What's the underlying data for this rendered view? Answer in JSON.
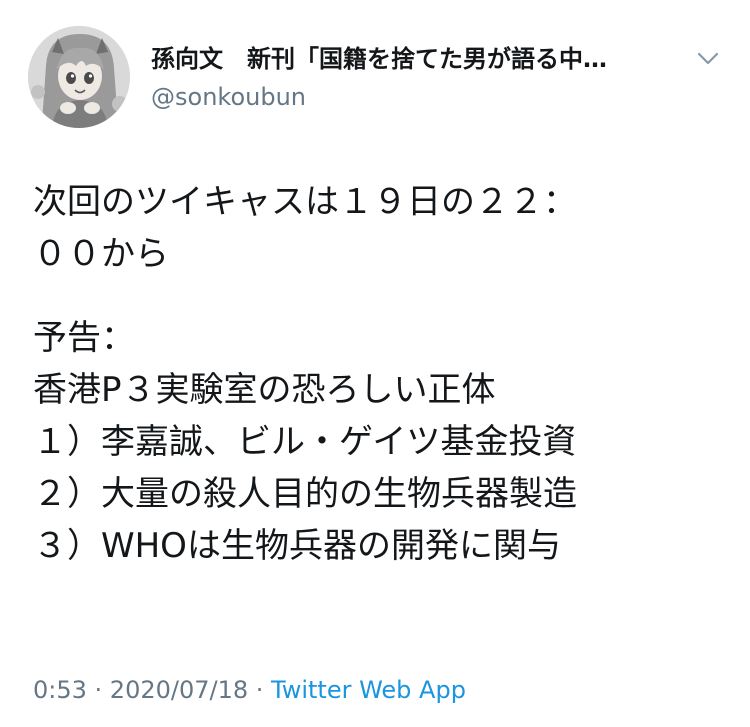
{
  "user": {
    "display_name": "孫向文　新刊「国籍を捨てた男が語る中…",
    "handle": "@sonkoubun",
    "avatar_icon": "anime-girl-avatar-icon"
  },
  "menu": {
    "icon": "chevron-down-icon"
  },
  "tweet": {
    "paragraph1": [
      "次回のツイキャスは１９日の２２：",
      "００から"
    ],
    "paragraph2": [
      "予告：",
      "香港P３実験室の恐ろしい正体",
      "１）李嘉誠、ビル・ゲイツ基金投資",
      "２）大量の殺人目的の生物兵器製造",
      "３）WHOは生物兵器の開発に関与"
    ]
  },
  "meta": {
    "time": "0:53",
    "separator": " · ",
    "date": "2020/07/18",
    "source": "Twitter Web App"
  },
  "colors": {
    "text": "#14171a",
    "secondary": "#657786",
    "link": "#1b95e0",
    "background": "#ffffff"
  }
}
